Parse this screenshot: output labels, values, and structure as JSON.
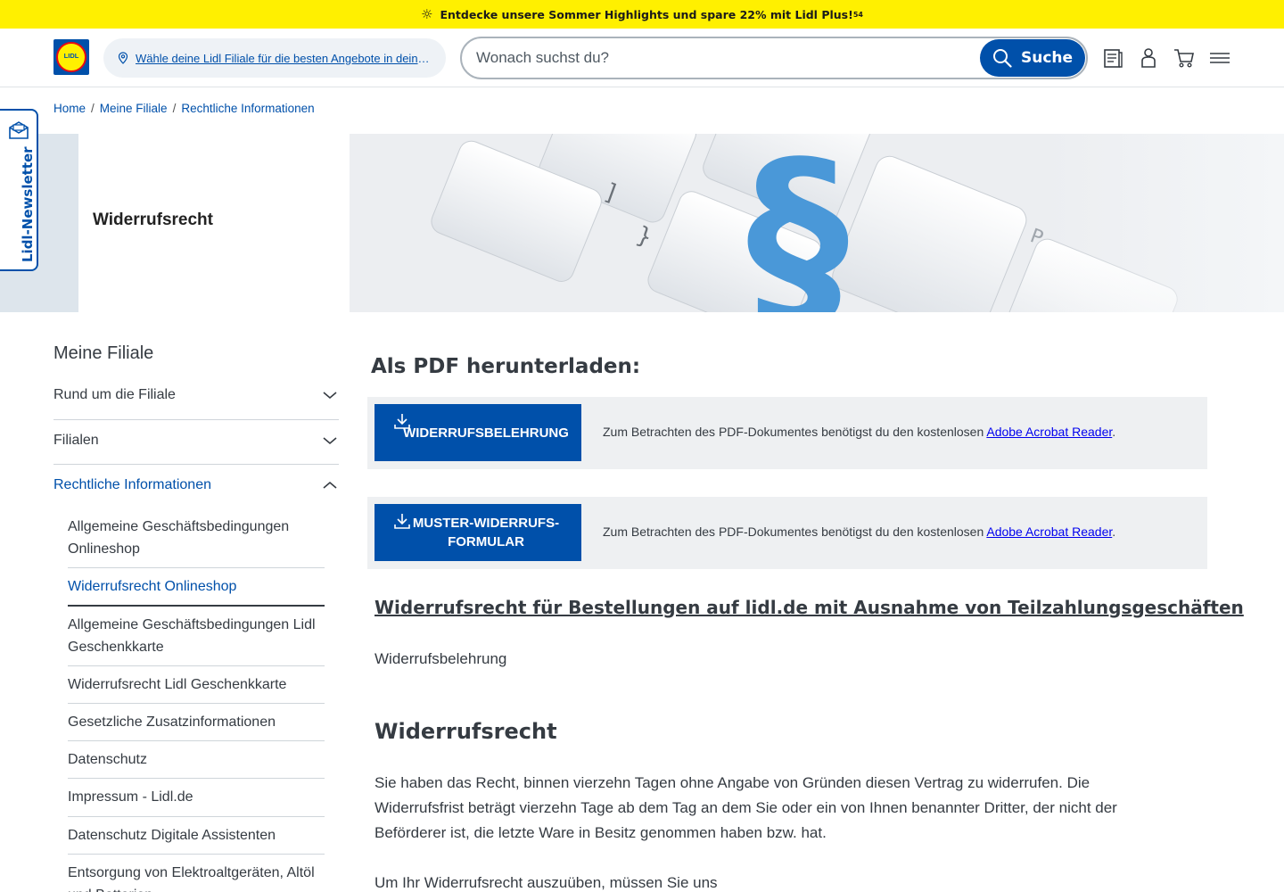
{
  "promo": {
    "text": "Entdecke unsere Sommer Highlights und spare 22% mit Lidl Plus!",
    "sup": "54"
  },
  "header": {
    "logo_text": "LIDL",
    "store_prompt": "Wähle deine Lidl Filiale für die besten Angebote in deiner Nähe",
    "search_placeholder": "Wonach suchst du?",
    "search_button": "Suche",
    "icons": [
      "flyer-icon",
      "account-icon",
      "cart-icon",
      "menu-icon"
    ]
  },
  "newsletter": {
    "label": "Lidl-Newsletter"
  },
  "breadcrumb": {
    "items": [
      "Home",
      "Meine Filiale",
      "Rechtliche Informationen"
    ],
    "separator": "/"
  },
  "hero": {
    "title": "Widerrufsrecht",
    "symbol": "§"
  },
  "sidebar": {
    "title": "Meine Filiale",
    "sections": [
      {
        "label": "Rund um die Filiale"
      },
      {
        "label": "Filialen"
      },
      {
        "label": "Rechtliche Informationen"
      }
    ],
    "subitems": [
      {
        "label": "Allgemeine Geschäftsbedingungen Onlineshop"
      },
      {
        "label": "Widerrufsrecht Onlineshop"
      },
      {
        "label": "Allgemeine Geschäftsbedingungen Lidl Geschenkkarte"
      },
      {
        "label": "Widerrufsrecht Lidl Geschenkkarte"
      },
      {
        "label": "Gesetzliche Zusatzinformationen"
      },
      {
        "label": "Datenschutz"
      },
      {
        "label": "Impressum - Lidl.de"
      },
      {
        "label": "Datenschutz Digitale Assistenten"
      },
      {
        "label": "Entsorgung von Elektroaltgeräten, Altöl und Batterien"
      }
    ]
  },
  "main": {
    "pdf_title": "Als PDF herunterladen:",
    "downloads": [
      {
        "button": "WIDERRUFSBELEHRUNG",
        "note": "Zum Betrachten des PDF-Dokumentes benötigst du den kostenlosen ",
        "link": "Adobe Acrobat Reader",
        "suffix": "."
      },
      {
        "button": "MUSTER-WIDERRUFS-FORMULAR",
        "note": "Zum Betrachten des PDF-Dokumentes benötigst du den kostenlosen ",
        "link": "Adobe Acrobat Reader",
        "suffix": "."
      }
    ],
    "section_link": "Widerrufsrecht für Bestellungen auf lidl.de mit Ausnahme von Teilzahlungsgeschäften",
    "subtitle": "Widerrufsbelehrung",
    "heading": "Widerrufsrecht",
    "paragraph1": "Sie haben das Recht, binnen vierzehn Tagen ohne Angabe von Gründen diesen Vertrag zu widerrufen. Die Widerrufsfrist beträgt vierzehn Tage ab dem Tag an dem Sie oder ein von Ihnen benannter Dritter, der nicht der Beförderer ist, die letzte Ware in Besitz genommen haben bzw. hat.",
    "paragraph2": "Um Ihr Widerrufsrecht auszuüben, müssen Sie uns"
  },
  "colors": {
    "brand_blue": "#0050aa",
    "promo_yellow": "#fff000",
    "text": "#353b42"
  }
}
